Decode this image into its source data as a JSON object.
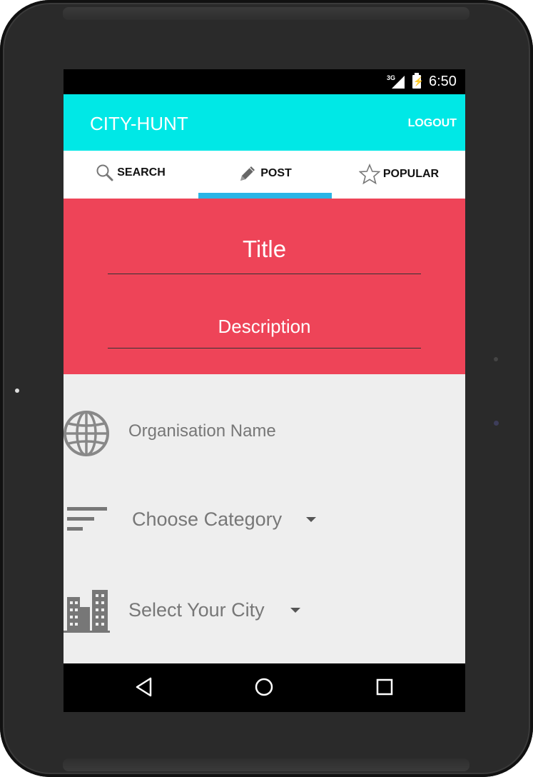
{
  "status_bar": {
    "network": "3G",
    "time": "6:50"
  },
  "app_bar": {
    "title": "CITY-HUNT",
    "logout_label": "LOGOUT"
  },
  "tabs": [
    {
      "label": "SEARCH",
      "icon": "search-icon"
    },
    {
      "label": "POST",
      "icon": "pencil-icon",
      "selected": true
    },
    {
      "label": "POPULAR",
      "icon": "star-icon"
    }
  ],
  "post_form": {
    "title_placeholder": "Title",
    "description_placeholder": "Description",
    "organisation_placeholder": "Organisation Name",
    "category_placeholder": "Choose Category",
    "city_placeholder": "Select Your City"
  },
  "colors": {
    "app_bar": "#00e8e6",
    "tab_indicator": "#2ab5e6",
    "red_panel": "#ee4458",
    "form_background": "#eeeeee"
  },
  "nav_bar": {
    "buttons": [
      "back-icon",
      "home-icon",
      "recents-icon"
    ]
  }
}
